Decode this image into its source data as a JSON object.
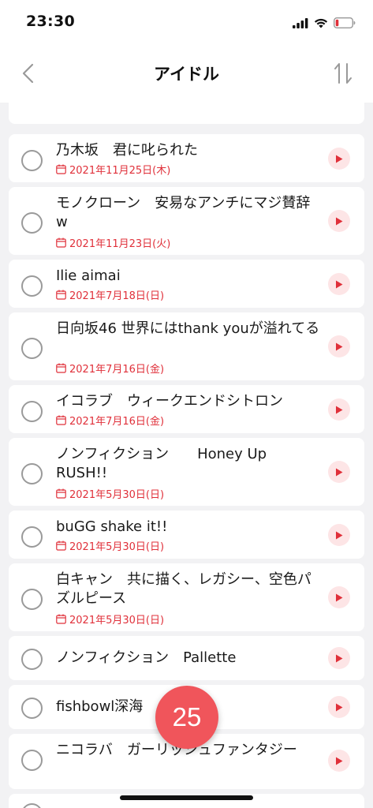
{
  "status_bar": {
    "time": "23:30",
    "icons": [
      "cellular-signal-icon",
      "wifi-icon",
      "battery-low-icon"
    ]
  },
  "nav": {
    "title": "アイドル",
    "back_icon": "chevron-left-icon",
    "sort_icon": "sort-arrows-icon"
  },
  "colors": {
    "accent": "#e0303a",
    "play_bg": "#fde5e6",
    "fab": "#f0555b",
    "background": "#f2f2f4"
  },
  "items": [
    {
      "title": "乃木坂　君に叱られた",
      "date": "2021年11月25日(木)"
    },
    {
      "title": "モノクローン　安易なアンチにマジ賛辞w",
      "date": "2021年11月23日(火)"
    },
    {
      "title": "Ilie aimai",
      "date": "2021年7月18日(日)"
    },
    {
      "title": "日向坂46 世界にはthank youが溢れてる",
      "date": "2021年7月16日(金)"
    },
    {
      "title": "イコラブ　ウィークエンドシトロン",
      "date": "2021年7月16日(金)"
    },
    {
      "title": "ノンフィクション　　Honey Up RUSH!!",
      "date": "2021年5月30日(日)"
    },
    {
      "title": "buGG shake it!!",
      "date": "2021年5月30日(日)"
    },
    {
      "title": "白キャン　共に描く、レガシー、空色パズルピース",
      "date": "2021年5月30日(日)"
    },
    {
      "title": "ノンフィクション　Pallette",
      "date": ""
    },
    {
      "title": "fishbowl深海",
      "date": ""
    },
    {
      "title": "ニコラバ　ガーリッシュファンタジー",
      "date": ""
    }
  ],
  "fab": {
    "count": "25"
  }
}
